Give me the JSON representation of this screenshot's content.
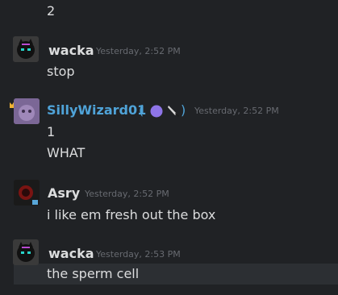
{
  "messages": [
    {
      "lines": [
        "2"
      ]
    },
    {
      "author": "wacka",
      "time": "Yesterday, 2:52 PM",
      "lines": [
        "stop"
      ],
      "avatar": "black-cat-avatar"
    },
    {
      "author": "SillyWizard01",
      "time": "Yesterday, 2:52 PM",
      "lines": [
        "1",
        "WHAT"
      ],
      "avatar": "purple-creature-avatar",
      "name_color": "#4fa3d8",
      "status_suffix": "( ",
      "status_suffix_end": " )",
      "status_icons": [
        "purple-circle-icon",
        "knife-icon"
      ],
      "crown": "crown-icon"
    },
    {
      "author": "Asry",
      "time": "Yesterday, 2:52 PM",
      "lines": [
        "i like em fresh out the box"
      ],
      "avatar": "red-dark-avatar"
    },
    {
      "author": "wacka",
      "time": "Yesterday, 2:53 PM",
      "lines": [
        "the sperm cell"
      ],
      "avatar": "black-cat-avatar"
    }
  ],
  "colors": {
    "background": "#202225",
    "text": "#dcddde",
    "muted": "#676a70",
    "hover": "#2c2f33"
  }
}
